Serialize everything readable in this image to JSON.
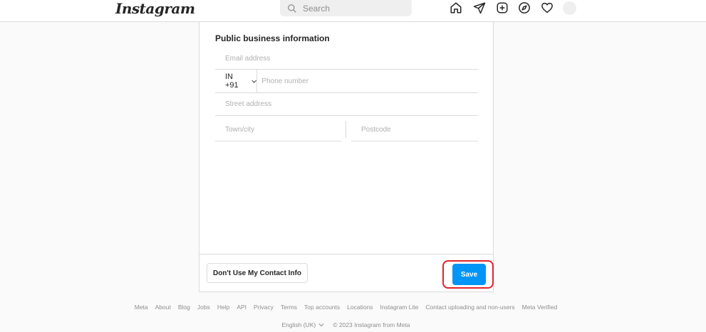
{
  "header": {
    "logo": "Instagram",
    "search": {
      "placeholder": "Search",
      "value": ""
    },
    "nav_icons": [
      "home-icon",
      "direct-icon",
      "new-post-icon",
      "explore-icon",
      "activity-icon",
      "profile-avatar"
    ]
  },
  "form": {
    "section_title": "Public business information",
    "email": {
      "placeholder": "Email address",
      "value": ""
    },
    "phone": {
      "country_code": "IN +91",
      "placeholder": "Phone number",
      "value": ""
    },
    "street": {
      "placeholder": "Street address",
      "value": ""
    },
    "town": {
      "placeholder": "Town/city",
      "value": ""
    },
    "postcode": {
      "placeholder": "Postcode",
      "value": ""
    }
  },
  "actions": {
    "secondary_label": "Don't Use My Contact Info",
    "save_label": "Save",
    "save_color": "#0095f6",
    "highlight_color": "#e0242a"
  },
  "footer": {
    "links": [
      "Meta",
      "About",
      "Blog",
      "Jobs",
      "Help",
      "API",
      "Privacy",
      "Terms",
      "Top accounts",
      "Locations",
      "Instagram Lite",
      "Contact uploading and non-users",
      "Meta Verified"
    ],
    "language": "English (UK)",
    "copyright": "© 2023 Instagram from Meta"
  }
}
